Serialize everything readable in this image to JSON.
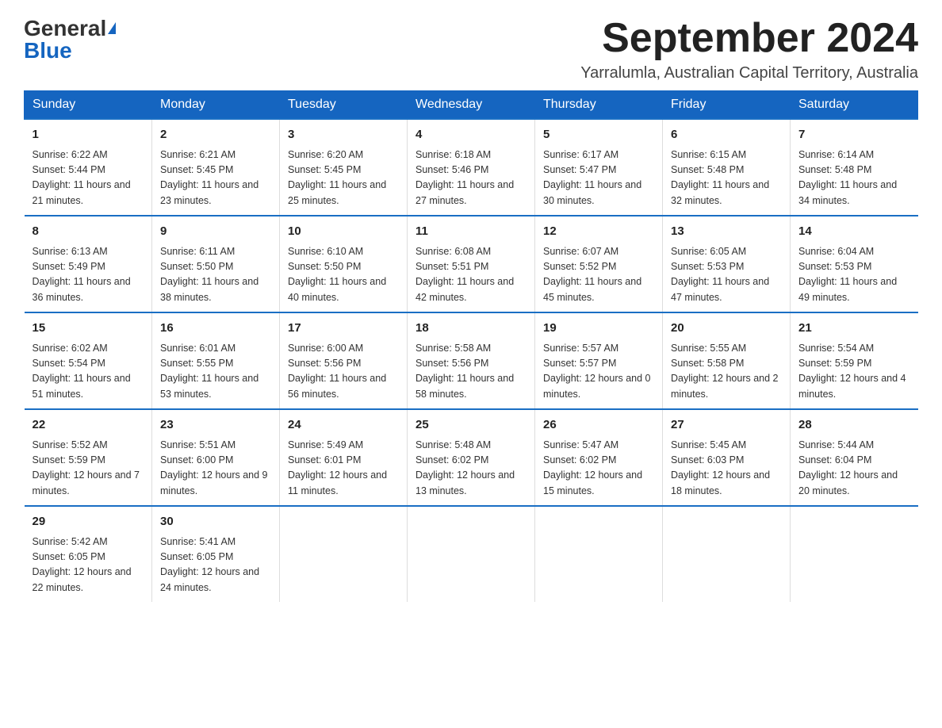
{
  "header": {
    "logo_general": "General",
    "logo_blue": "Blue",
    "main_title": "September 2024",
    "subtitle": "Yarralumla, Australian Capital Territory, Australia"
  },
  "days_of_week": [
    "Sunday",
    "Monday",
    "Tuesday",
    "Wednesday",
    "Thursday",
    "Friday",
    "Saturday"
  ],
  "weeks": [
    [
      {
        "day": "1",
        "sunrise": "6:22 AM",
        "sunset": "5:44 PM",
        "daylight": "11 hours and 21 minutes."
      },
      {
        "day": "2",
        "sunrise": "6:21 AM",
        "sunset": "5:45 PM",
        "daylight": "11 hours and 23 minutes."
      },
      {
        "day": "3",
        "sunrise": "6:20 AM",
        "sunset": "5:45 PM",
        "daylight": "11 hours and 25 minutes."
      },
      {
        "day": "4",
        "sunrise": "6:18 AM",
        "sunset": "5:46 PM",
        "daylight": "11 hours and 27 minutes."
      },
      {
        "day": "5",
        "sunrise": "6:17 AM",
        "sunset": "5:47 PM",
        "daylight": "11 hours and 30 minutes."
      },
      {
        "day": "6",
        "sunrise": "6:15 AM",
        "sunset": "5:48 PM",
        "daylight": "11 hours and 32 minutes."
      },
      {
        "day": "7",
        "sunrise": "6:14 AM",
        "sunset": "5:48 PM",
        "daylight": "11 hours and 34 minutes."
      }
    ],
    [
      {
        "day": "8",
        "sunrise": "6:13 AM",
        "sunset": "5:49 PM",
        "daylight": "11 hours and 36 minutes."
      },
      {
        "day": "9",
        "sunrise": "6:11 AM",
        "sunset": "5:50 PM",
        "daylight": "11 hours and 38 minutes."
      },
      {
        "day": "10",
        "sunrise": "6:10 AM",
        "sunset": "5:50 PM",
        "daylight": "11 hours and 40 minutes."
      },
      {
        "day": "11",
        "sunrise": "6:08 AM",
        "sunset": "5:51 PM",
        "daylight": "11 hours and 42 minutes."
      },
      {
        "day": "12",
        "sunrise": "6:07 AM",
        "sunset": "5:52 PM",
        "daylight": "11 hours and 45 minutes."
      },
      {
        "day": "13",
        "sunrise": "6:05 AM",
        "sunset": "5:53 PM",
        "daylight": "11 hours and 47 minutes."
      },
      {
        "day": "14",
        "sunrise": "6:04 AM",
        "sunset": "5:53 PM",
        "daylight": "11 hours and 49 minutes."
      }
    ],
    [
      {
        "day": "15",
        "sunrise": "6:02 AM",
        "sunset": "5:54 PM",
        "daylight": "11 hours and 51 minutes."
      },
      {
        "day": "16",
        "sunrise": "6:01 AM",
        "sunset": "5:55 PM",
        "daylight": "11 hours and 53 minutes."
      },
      {
        "day": "17",
        "sunrise": "6:00 AM",
        "sunset": "5:56 PM",
        "daylight": "11 hours and 56 minutes."
      },
      {
        "day": "18",
        "sunrise": "5:58 AM",
        "sunset": "5:56 PM",
        "daylight": "11 hours and 58 minutes."
      },
      {
        "day": "19",
        "sunrise": "5:57 AM",
        "sunset": "5:57 PM",
        "daylight": "12 hours and 0 minutes."
      },
      {
        "day": "20",
        "sunrise": "5:55 AM",
        "sunset": "5:58 PM",
        "daylight": "12 hours and 2 minutes."
      },
      {
        "day": "21",
        "sunrise": "5:54 AM",
        "sunset": "5:59 PM",
        "daylight": "12 hours and 4 minutes."
      }
    ],
    [
      {
        "day": "22",
        "sunrise": "5:52 AM",
        "sunset": "5:59 PM",
        "daylight": "12 hours and 7 minutes."
      },
      {
        "day": "23",
        "sunrise": "5:51 AM",
        "sunset": "6:00 PM",
        "daylight": "12 hours and 9 minutes."
      },
      {
        "day": "24",
        "sunrise": "5:49 AM",
        "sunset": "6:01 PM",
        "daylight": "12 hours and 11 minutes."
      },
      {
        "day": "25",
        "sunrise": "5:48 AM",
        "sunset": "6:02 PM",
        "daylight": "12 hours and 13 minutes."
      },
      {
        "day": "26",
        "sunrise": "5:47 AM",
        "sunset": "6:02 PM",
        "daylight": "12 hours and 15 minutes."
      },
      {
        "day": "27",
        "sunrise": "5:45 AM",
        "sunset": "6:03 PM",
        "daylight": "12 hours and 18 minutes."
      },
      {
        "day": "28",
        "sunrise": "5:44 AM",
        "sunset": "6:04 PM",
        "daylight": "12 hours and 20 minutes."
      }
    ],
    [
      {
        "day": "29",
        "sunrise": "5:42 AM",
        "sunset": "6:05 PM",
        "daylight": "12 hours and 22 minutes."
      },
      {
        "day": "30",
        "sunrise": "5:41 AM",
        "sunset": "6:05 PM",
        "daylight": "12 hours and 24 minutes."
      },
      null,
      null,
      null,
      null,
      null
    ]
  ],
  "labels": {
    "sunrise": "Sunrise:",
    "sunset": "Sunset:",
    "daylight": "Daylight:"
  }
}
